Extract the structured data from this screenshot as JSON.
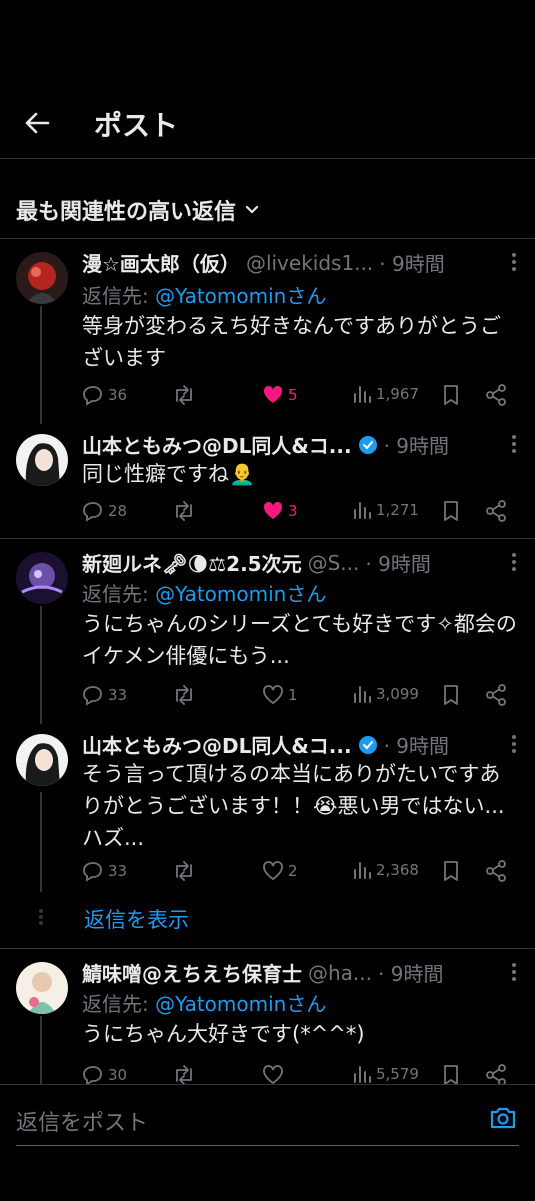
{
  "header": {
    "title": "ポスト",
    "back_icon": "arrow-left-icon"
  },
  "sort": {
    "label": "最も関連性の高い返信"
  },
  "colors": {
    "accent": "#1d9bf0",
    "like": "#f91880",
    "text": "#e7e9ea",
    "muted": "#71767b",
    "bg": "#000000"
  },
  "tweets": [
    {
      "name": "漫☆画太郎（仮）",
      "handle": "@livekids1...",
      "time": "· 9時間",
      "verified": false,
      "reply_prefix": "返信先: ",
      "reply_mention": "@Yatomominさん",
      "text": "等身が変わるえち好きなんですありがとうございます",
      "replies": "36",
      "retweets": "",
      "likes": "5",
      "liked": true,
      "views": "1,967"
    },
    {
      "name": "山本ともみつ@DL同人&コ...",
      "handle": "",
      "time": "· 9時間",
      "verified": true,
      "text": "同じ性癖ですね👨‍🦲",
      "replies": "28",
      "retweets": "",
      "likes": "3",
      "liked": true,
      "views": "1,271"
    },
    {
      "name": "新廻ルネ🗝🌘⚖2.5次元",
      "handle": "@S...",
      "time": "· 9時間",
      "verified": false,
      "reply_prefix": "返信先: ",
      "reply_mention": "@Yatomominさん",
      "text": "うにちゃんのシリーズとても好きです✧都会のイケメン俳優にもう...",
      "replies": "33",
      "retweets": "",
      "likes": "1",
      "liked": false,
      "views": "3,099"
    },
    {
      "name": "山本ともみつ@DL同人&コ...",
      "handle": "",
      "time": "· 9時間",
      "verified": true,
      "text": "そう言って頂けるの本当にありがたいですありがとうございます！！😭悪い男ではない...ハズ...",
      "replies": "33",
      "retweets": "",
      "likes": "2",
      "liked": false,
      "views": "2,368"
    },
    {
      "name": "鯖味噌@えちえち保育士",
      "handle": "@ha...",
      "time": "· 9時間",
      "verified": false,
      "reply_prefix": "返信先: ",
      "reply_mention": "@Yatomominさん",
      "text": "うにちゃん大好きです(*^^*)",
      "replies": "30",
      "retweets": "",
      "likes": "",
      "liked": false,
      "views": "5,579"
    }
  ],
  "show_replies": "返信を表示",
  "reply_box": {
    "placeholder": "返信をポスト",
    "icon": "camera-icon"
  }
}
